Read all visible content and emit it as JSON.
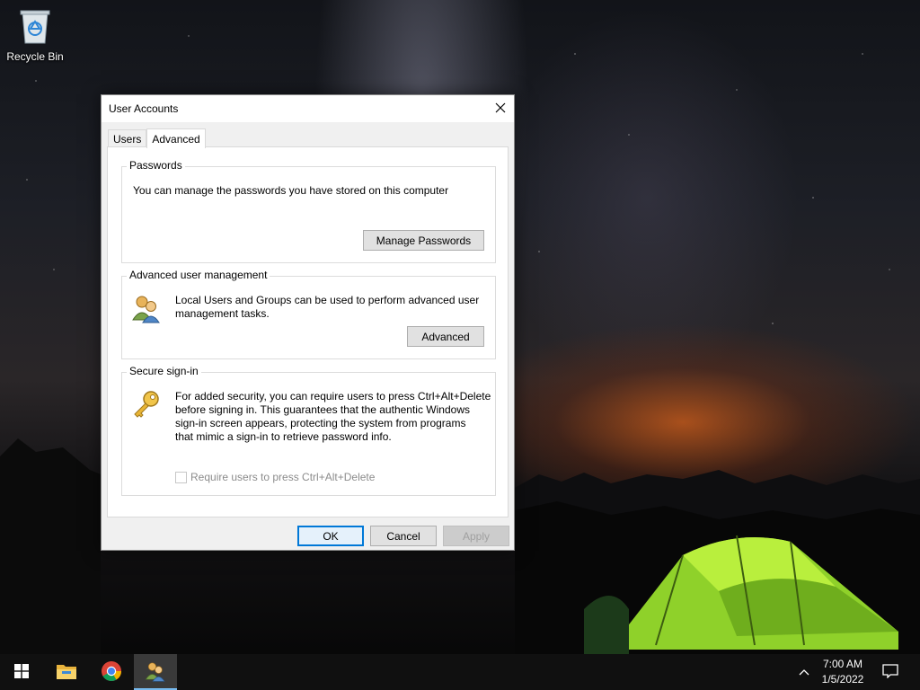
{
  "desktop": {
    "icons": [
      {
        "label": "Recycle Bin",
        "icon": "recycle-bin-icon"
      }
    ]
  },
  "dialog": {
    "title": "User Accounts",
    "tabs": [
      {
        "label": "Users",
        "active": false
      },
      {
        "label": "Advanced",
        "active": true
      }
    ],
    "passwords": {
      "title": "Passwords",
      "text": "You can manage the passwords you have stored on this computer",
      "button": "Manage Passwords"
    },
    "advanced_user_management": {
      "title": "Advanced user management",
      "text_line1": "Local Users and Groups can be used to perform advanced user",
      "text_line2": "management tasks.",
      "button": "Advanced",
      "icon": "users-icon"
    },
    "secure_signin": {
      "title": "Secure sign-in",
      "text_line1": "For added security, you can require users to press Ctrl+Alt+Delete",
      "text_line2": "before signing in. This guarantees that the authentic Windows",
      "text_line3": "sign-in screen appears, protecting the system from programs",
      "text_line4": "that mimic a sign-in to retrieve password info.",
      "checkbox_label": "Require users to press Ctrl+Alt+Delete",
      "checkbox_checked": false,
      "checkbox_enabled": false,
      "icon": "key-icon"
    },
    "buttons": {
      "ok": "OK",
      "cancel": "Cancel",
      "apply": "Apply"
    }
  },
  "taskbar": {
    "items": [
      {
        "name": "start",
        "icon": "windows-logo-icon"
      },
      {
        "name": "file-explorer",
        "icon": "folder-icon"
      },
      {
        "name": "chrome",
        "icon": "chrome-icon"
      },
      {
        "name": "user-accounts",
        "icon": "users-icon",
        "active": true
      }
    ],
    "time": "7:00 AM",
    "date": "1/5/2022",
    "accent_color": "#76b9ed"
  }
}
